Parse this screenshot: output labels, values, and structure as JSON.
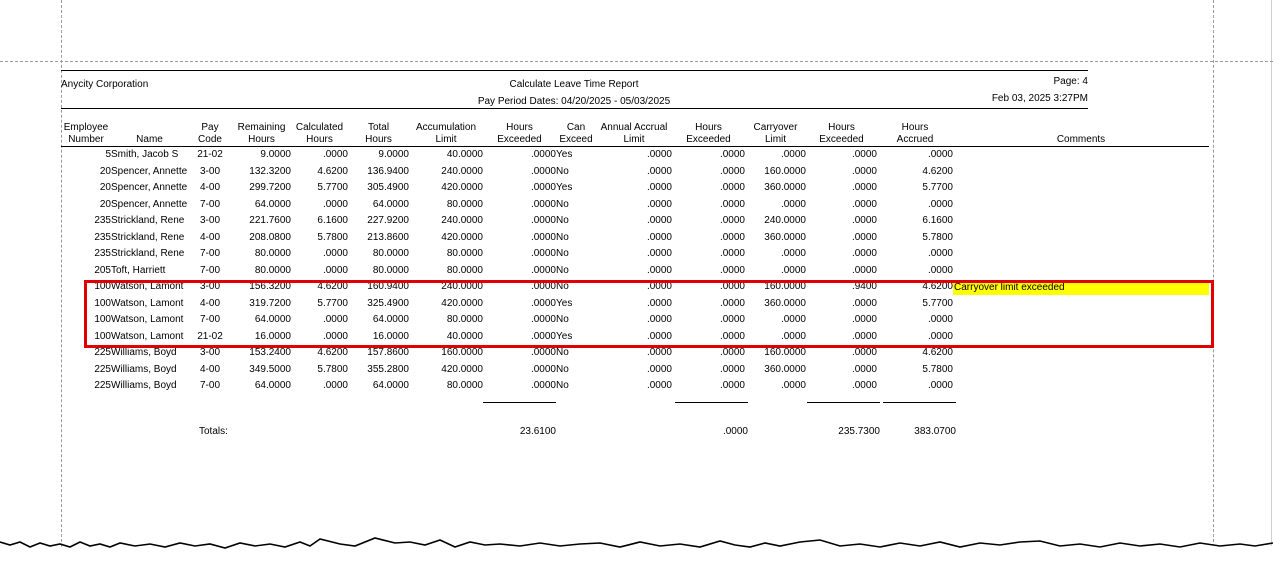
{
  "header": {
    "company": "Anycity Corporation",
    "report_title": "Calculate Leave Time Report",
    "pay_period": "Pay Period Dates: 04/20/2025 - 05/03/2025",
    "page": "Page: 4",
    "printed": "Feb 03, 2025 3:27PM"
  },
  "columns": [
    {
      "l1": "Employee",
      "l2": "Number"
    },
    {
      "l1": "",
      "l2": "Name"
    },
    {
      "l1": "Pay",
      "l2": "Code"
    },
    {
      "l1": "Remaining",
      "l2": "Hours"
    },
    {
      "l1": "Calculated",
      "l2": "Hours"
    },
    {
      "l1": "Total",
      "l2": "Hours"
    },
    {
      "l1": "Accumulation",
      "l2": "Limit"
    },
    {
      "l1": "Hours",
      "l2": "Exceeded"
    },
    {
      "l1": "Can",
      "l2": "Exceed"
    },
    {
      "l1": "Annual Accrual",
      "l2": "Limit"
    },
    {
      "l1": "Hours",
      "l2": "Exceeded"
    },
    {
      "l1": "Carryover",
      "l2": "Limit"
    },
    {
      "l1": "Hours",
      "l2": "Exceeded"
    },
    {
      "l1": "Hours",
      "l2": "Accrued"
    },
    {
      "l1": "",
      "l2": "Comments"
    }
  ],
  "rows": [
    [
      "5",
      "Smith, Jacob S",
      "21-02",
      "9.0000",
      ".0000",
      "9.0000",
      "40.0000",
      ".0000",
      "Yes",
      ".0000",
      ".0000",
      ".0000",
      ".0000",
      ".0000",
      ""
    ],
    [
      "20",
      "Spencer, Annette",
      "3-00",
      "132.3200",
      "4.6200",
      "136.9400",
      "240.0000",
      ".0000",
      "No",
      ".0000",
      ".0000",
      "160.0000",
      ".0000",
      "4.6200",
      ""
    ],
    [
      "20",
      "Spencer, Annette",
      "4-00",
      "299.7200",
      "5.7700",
      "305.4900",
      "420.0000",
      ".0000",
      "Yes",
      ".0000",
      ".0000",
      "360.0000",
      ".0000",
      "5.7700",
      ""
    ],
    [
      "20",
      "Spencer, Annette",
      "7-00",
      "64.0000",
      ".0000",
      "64.0000",
      "80.0000",
      ".0000",
      "No",
      ".0000",
      ".0000",
      ".0000",
      ".0000",
      ".0000",
      ""
    ],
    [
      "235",
      "Strickland, Rene",
      "3-00",
      "221.7600",
      "6.1600",
      "227.9200",
      "240.0000",
      ".0000",
      "No",
      ".0000",
      ".0000",
      "240.0000",
      ".0000",
      "6.1600",
      ""
    ],
    [
      "235",
      "Strickland, Rene",
      "4-00",
      "208.0800",
      "5.7800",
      "213.8600",
      "420.0000",
      ".0000",
      "No",
      ".0000",
      ".0000",
      "360.0000",
      ".0000",
      "5.7800",
      ""
    ],
    [
      "235",
      "Strickland, Rene",
      "7-00",
      "80.0000",
      ".0000",
      "80.0000",
      "80.0000",
      ".0000",
      "No",
      ".0000",
      ".0000",
      ".0000",
      ".0000",
      ".0000",
      ""
    ],
    [
      "205",
      "Toft, Harriett",
      "7-00",
      "80.0000",
      ".0000",
      "80.0000",
      "80.0000",
      ".0000",
      "No",
      ".0000",
      ".0000",
      ".0000",
      ".0000",
      ".0000",
      ""
    ],
    [
      "100",
      "Watson, Lamont",
      "3-00",
      "156.3200",
      "4.6200",
      "160.9400",
      "240.0000",
      ".0000",
      "No",
      ".0000",
      ".0000",
      "160.0000",
      ".9400",
      "4.6200",
      "Carryover limit exceeded"
    ],
    [
      "100",
      "Watson, Lamont",
      "4-00",
      "319.7200",
      "5.7700",
      "325.4900",
      "420.0000",
      ".0000",
      "Yes",
      ".0000",
      ".0000",
      "360.0000",
      ".0000",
      "5.7700",
      ""
    ],
    [
      "100",
      "Watson, Lamont",
      "7-00",
      "64.0000",
      ".0000",
      "64.0000",
      "80.0000",
      ".0000",
      "No",
      ".0000",
      ".0000",
      ".0000",
      ".0000",
      ".0000",
      ""
    ],
    [
      "100",
      "Watson, Lamont",
      "21-02",
      "16.0000",
      ".0000",
      "16.0000",
      "40.0000",
      ".0000",
      "Yes",
      ".0000",
      ".0000",
      ".0000",
      ".0000",
      ".0000",
      ""
    ],
    [
      "225",
      "Williams, Boyd",
      "3-00",
      "153.2400",
      "4.6200",
      "157.8600",
      "160.0000",
      ".0000",
      "No",
      ".0000",
      ".0000",
      "160.0000",
      ".0000",
      "4.6200",
      ""
    ],
    [
      "225",
      "Williams, Boyd",
      "4-00",
      "349.5000",
      "5.7800",
      "355.2800",
      "420.0000",
      ".0000",
      "No",
      ".0000",
      ".0000",
      "360.0000",
      ".0000",
      "5.7800",
      ""
    ],
    [
      "225",
      "Williams, Boyd",
      "7-00",
      "64.0000",
      ".0000",
      "64.0000",
      "80.0000",
      ".0000",
      "No",
      ".0000",
      ".0000",
      ".0000",
      ".0000",
      ".0000",
      ""
    ]
  ],
  "totals": {
    "label": "Totals:",
    "hours_exceeded_accum": "23.6100",
    "hours_exceeded_annual": ".0000",
    "hours_exceeded_carryover": "235.7300",
    "hours_accrued": "383.0700"
  },
  "colors": {
    "highlight_box": "#e00000",
    "comment_highlight": "#ffff00"
  }
}
